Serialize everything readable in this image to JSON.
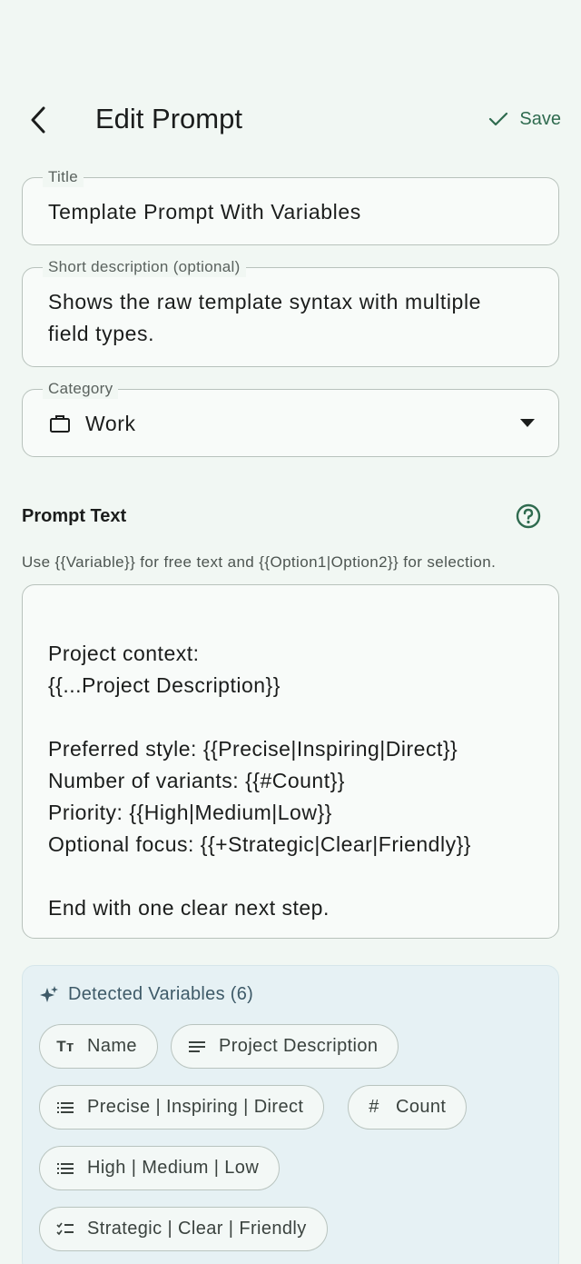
{
  "header": {
    "title": "Edit Prompt",
    "save_label": "Save"
  },
  "title_field": {
    "label": "Title",
    "value": "Template Prompt With Variables"
  },
  "description_field": {
    "label": "Short description (optional)",
    "line1": "Shows the raw template syntax with multiple",
    "line2": "field types."
  },
  "category_field": {
    "label": "Category",
    "value": "Work",
    "icon": "briefcase-icon"
  },
  "prompt_section": {
    "title": "Prompt Text",
    "hint": "Use {{Variable}} for free text and {{Option1|Option2}} for selection.",
    "lines": [
      "",
      "Project context:",
      "{{...Project Description}}",
      "",
      "Preferred style: {{Precise|Inspiring|Direct}}",
      "Number of variants: {{#Count}}",
      "Priority: {{High|Medium|Low}}",
      "Optional focus: {{+Strategic|Clear|Friendly}}",
      "",
      "End with one clear next step."
    ]
  },
  "detected": {
    "title": "Detected Variables (6)",
    "chips": [
      {
        "label": "Name",
        "icon": "text-type-icon"
      },
      {
        "label": "Project Description",
        "icon": "paragraph-icon"
      },
      {
        "label": "Precise | Inspiring | Direct",
        "icon": "list-icon"
      },
      {
        "label": "Count",
        "icon": "hash-icon"
      },
      {
        "label": "High | Medium | Low",
        "icon": "list-icon"
      },
      {
        "label": "Strategic | Clear | Friendly",
        "icon": "checklist-icon"
      }
    ]
  },
  "colors": {
    "accent": "#2f6b4f",
    "background": "#f1f7f3",
    "variables_bg": "#e6f1f4"
  }
}
